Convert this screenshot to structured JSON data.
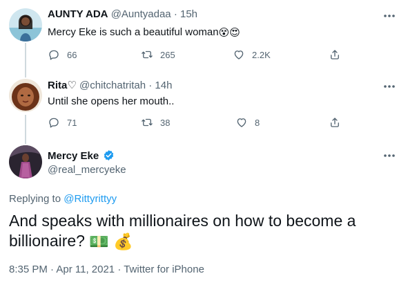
{
  "tweets": [
    {
      "name": "AUNTY ADA",
      "handle": "@Auntyadaa",
      "separator": "·",
      "time": "15h",
      "text": "Mercy Eke is such a beautiful woman",
      "emojis": [
        "😵",
        "😍"
      ],
      "replies": "66",
      "retweets": "265",
      "likes": "2.2K"
    },
    {
      "name": "Rita♡",
      "handle": "@chitchatritah",
      "separator": "·",
      "time": "14h",
      "text": "Until she opens her mouth..",
      "replies": "71",
      "retweets": "38",
      "likes": "8"
    }
  ],
  "main": {
    "name": "Mercy Eke",
    "handle": "@real_mercyeke",
    "replying_prefix": "Replying to ",
    "replying_to": "@Rittyrittyy",
    "text": "And speaks with millionaires on how to become a billionaire?",
    "emojis": [
      "💵",
      "💰"
    ],
    "timestamp": "8:35 PM · Apr 11, 2021 · Twitter for iPhone"
  },
  "icons": {
    "reply": "reply-icon",
    "retweet": "retweet-icon",
    "like": "heart-icon",
    "share": "share-icon",
    "more": "more-icon",
    "verified": "verified-badge-icon"
  },
  "colors": {
    "accent": "#1d9bf0",
    "muted": "#536471",
    "text": "#0f1419",
    "thread_line": "#cfd9de"
  }
}
